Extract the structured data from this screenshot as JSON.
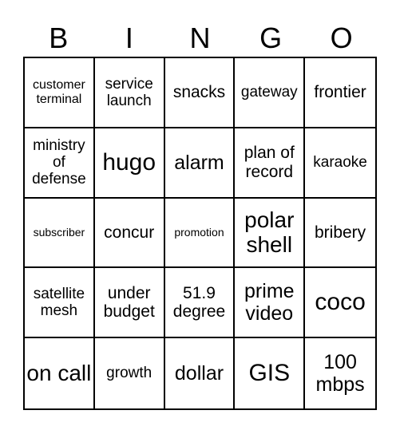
{
  "header": {
    "letters": [
      "B",
      "I",
      "N",
      "G",
      "O"
    ]
  },
  "cells": [
    [
      {
        "text": "customer terminal",
        "size": "s-sm"
      },
      {
        "text": "service launch",
        "size": "s-md"
      },
      {
        "text": "snacks",
        "size": "s-lg"
      },
      {
        "text": "gateway",
        "size": "s-md"
      },
      {
        "text": "frontier",
        "size": "s-lg"
      }
    ],
    [
      {
        "text": "ministry of defense",
        "size": "s-md"
      },
      {
        "text": "hugo",
        "size": "s-huge"
      },
      {
        "text": "alarm",
        "size": "s-xl"
      },
      {
        "text": "plan of record",
        "size": "s-lg"
      },
      {
        "text": "karaoke",
        "size": "s-md"
      }
    ],
    [
      {
        "text": "subscriber",
        "size": "s-xs"
      },
      {
        "text": "concur",
        "size": "s-lg"
      },
      {
        "text": "promotion",
        "size": "s-xs"
      },
      {
        "text": "polar shell",
        "size": "s-xxl"
      },
      {
        "text": "bribery",
        "size": "s-lg"
      }
    ],
    [
      {
        "text": "satellite mesh",
        "size": "s-md"
      },
      {
        "text": "under budget",
        "size": "s-lg"
      },
      {
        "text": "51.9 degree",
        "size": "s-lg"
      },
      {
        "text": "prime video",
        "size": "s-xl"
      },
      {
        "text": "coco",
        "size": "s-huge"
      }
    ],
    [
      {
        "text": "on call",
        "size": "s-xxl"
      },
      {
        "text": "growth",
        "size": "s-md"
      },
      {
        "text": "dollar",
        "size": "s-xl"
      },
      {
        "text": "GIS",
        "size": "s-huge"
      },
      {
        "text": "100 mbps",
        "size": "s-xl"
      }
    ]
  ]
}
